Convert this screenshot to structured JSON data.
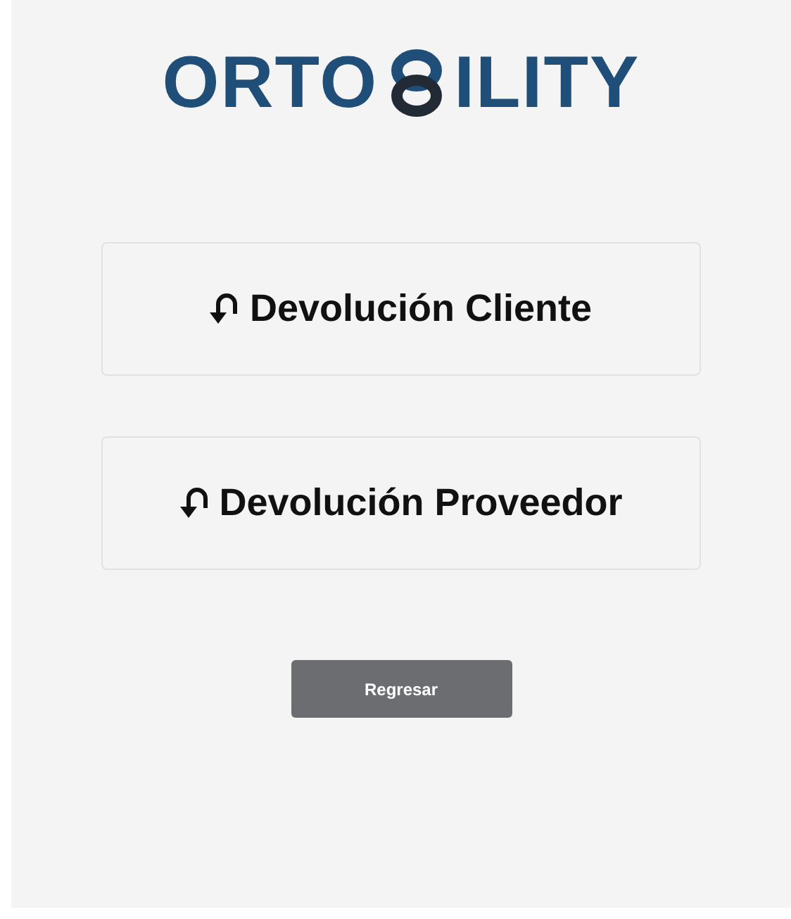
{
  "logo": {
    "left": "ORTO",
    "right": "ILITY"
  },
  "options": [
    {
      "label": "Devolución Cliente"
    },
    {
      "label": "Devolución Proveedor"
    }
  ],
  "back_button": {
    "label": "Regresar"
  }
}
